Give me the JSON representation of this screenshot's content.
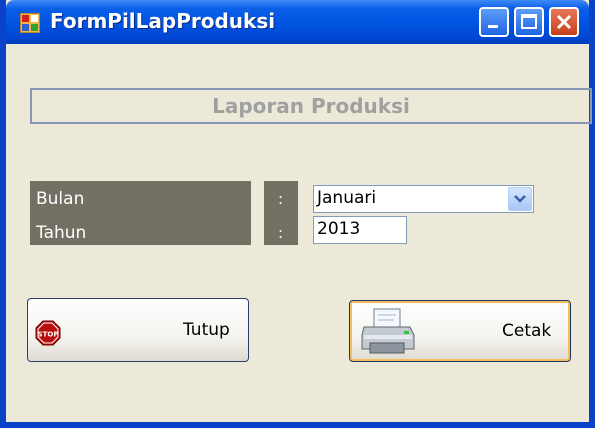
{
  "window": {
    "title": "FormPilLapProduksi",
    "controls": [
      "minimize",
      "maximize",
      "close"
    ]
  },
  "header": {
    "title": "Laporan Produksi"
  },
  "form": {
    "bulan_label": "Bulan",
    "tahun_label": "Tahun",
    "colon_bulan": ":",
    "colon_tahun": ":",
    "bulan_value": "Januari",
    "tahun_value": "2013"
  },
  "buttons": {
    "tutup_label": "Tutup",
    "cetak_label": "Cetak",
    "stop_icon_text": "STOP"
  },
  "colors": {
    "titlebar": "#0053e0",
    "window_face": "#ece9d8",
    "label_panel": "#717063",
    "close_button": "#c8401c",
    "default_button_highlight": "#f6be58"
  },
  "icons": {
    "window": "form-app-icon",
    "minimize": "minimize-icon",
    "maximize": "maximize-icon",
    "close": "close-icon",
    "dropdown": "chevron-down-icon",
    "tutup": "stop-sign-icon",
    "cetak": "printer-icon"
  }
}
